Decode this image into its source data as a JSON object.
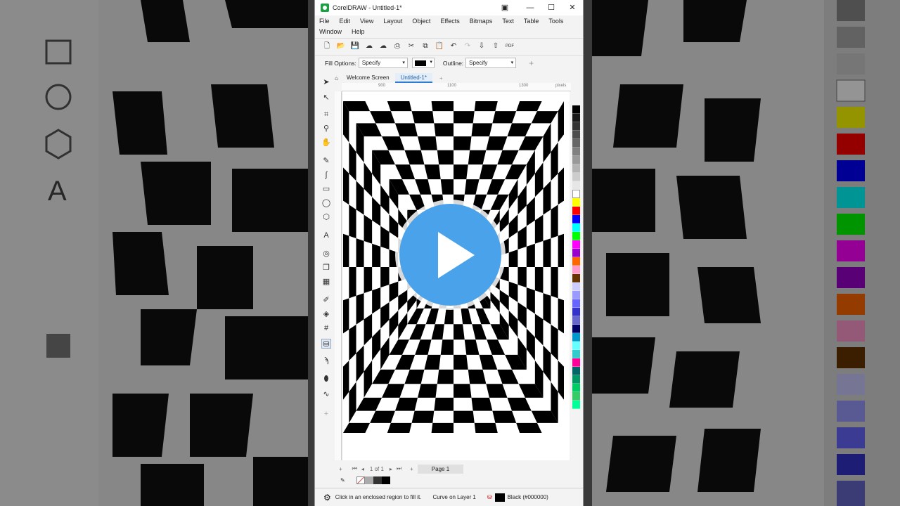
{
  "window": {
    "title": "CorelDRAW - Untitled-1*",
    "controls": [
      "restore-icon",
      "minimize-icon",
      "maximize-icon",
      "close-icon"
    ]
  },
  "menu": {
    "row1": [
      "File",
      "Edit",
      "View",
      "Layout",
      "Object",
      "Effects",
      "Bitmaps",
      "Text",
      "Table",
      "Tools"
    ],
    "row2": [
      "Window",
      "Help"
    ]
  },
  "propbar": {
    "fill_label": "Fill Options:",
    "fill_value": "Specify",
    "outline_label": "Outline:",
    "outline_value": "Specify"
  },
  "tabs": [
    {
      "label": "Welcome Screen",
      "active": false
    },
    {
      "label": "Untitled-1*",
      "active": true
    }
  ],
  "ruler_labels": [
    "900",
    "1100",
    "1300",
    "pixels"
  ],
  "pages": {
    "nav": "1 of 1",
    "current": "Page 1"
  },
  "status": {
    "hint": "Click in an enclosed region to fill it.",
    "object": "Curve on Layer 1",
    "fill": "Black (#000000)"
  },
  "colors": {
    "accent": "#2e7cd6",
    "play_button": "#4aa3ea",
    "palette": [
      "#000000",
      "#1a1a1a",
      "#333333",
      "#4d4d4d",
      "#666666",
      "#808080",
      "#999999",
      "#b3b3b3",
      "#cccccc",
      "#e6e6e6",
      "#ffffff",
      "#ffff00",
      "#ff0000",
      "#0000ff",
      "#00ffff",
      "#00ff00",
      "#ff00ff",
      "#9900cc",
      "#ff6600",
      "#ff99cc",
      "#663300",
      "#ccccff",
      "#9999ff",
      "#6666ff",
      "#3333cc",
      "#6666cc",
      "#000066",
      "#0099cc",
      "#66ffff",
      "#33cccc",
      "#ff0099",
      "#006666",
      "#009966",
      "#00cc66",
      "#33cc66",
      "#00ff99"
    ]
  },
  "play_icon": "play-icon"
}
